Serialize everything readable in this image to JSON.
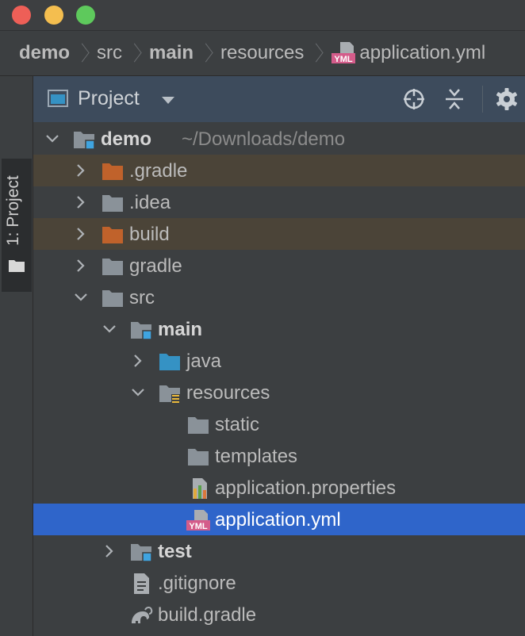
{
  "breadcrumb": [
    {
      "label": "demo",
      "bold": true
    },
    {
      "label": "src",
      "bold": false
    },
    {
      "label": "main",
      "bold": true
    },
    {
      "label": "resources",
      "bold": false
    },
    {
      "label": "application.yml",
      "bold": false,
      "icon": "yml-file-icon",
      "icon_text": "YML"
    }
  ],
  "side_tab": {
    "label": "1: Project"
  },
  "header": {
    "title": "Project"
  },
  "tree": [
    {
      "label": "demo",
      "sub": "~/Downloads/demo",
      "depth": 0,
      "arrow": "down",
      "icon": "module-folder",
      "bold": true
    },
    {
      "label": ".gradle",
      "depth": 1,
      "arrow": "right",
      "icon": "excluded-folder",
      "excluded": true
    },
    {
      "label": ".idea",
      "depth": 1,
      "arrow": "right",
      "icon": "folder"
    },
    {
      "label": "build",
      "depth": 1,
      "arrow": "right",
      "icon": "excluded-folder",
      "excluded": true
    },
    {
      "label": "gradle",
      "depth": 1,
      "arrow": "right",
      "icon": "folder"
    },
    {
      "label": "src",
      "depth": 1,
      "arrow": "down",
      "icon": "folder"
    },
    {
      "label": "main",
      "depth": 2,
      "arrow": "down",
      "icon": "module-folder",
      "bold": true
    },
    {
      "label": "java",
      "depth": 3,
      "arrow": "right",
      "icon": "source-folder"
    },
    {
      "label": "resources",
      "depth": 3,
      "arrow": "down",
      "icon": "resources-folder"
    },
    {
      "label": "static",
      "depth": 4,
      "icon": "folder"
    },
    {
      "label": "templates",
      "depth": 4,
      "icon": "folder"
    },
    {
      "label": "application.properties",
      "depth": 4,
      "icon": "properties-file"
    },
    {
      "label": "application.yml",
      "depth": 4,
      "icon": "yml-file",
      "selected": true
    },
    {
      "label": "test",
      "depth": 2,
      "arrow": "right",
      "icon": "module-folder",
      "bold": true
    },
    {
      "label": ".gitignore",
      "depth": 2,
      "icon": "text-file"
    },
    {
      "label": "build.gradle",
      "depth": 2,
      "icon": "gradle-file"
    }
  ],
  "colors": {
    "selection": "#2f65ca",
    "excluded_row": "#4b4438",
    "excluded_folder": "#c0622b",
    "folder": "#8a9299",
    "source_folder": "#3592c4",
    "module_badge": "#3fa4e0",
    "yml_badge": "#d45c8a"
  }
}
